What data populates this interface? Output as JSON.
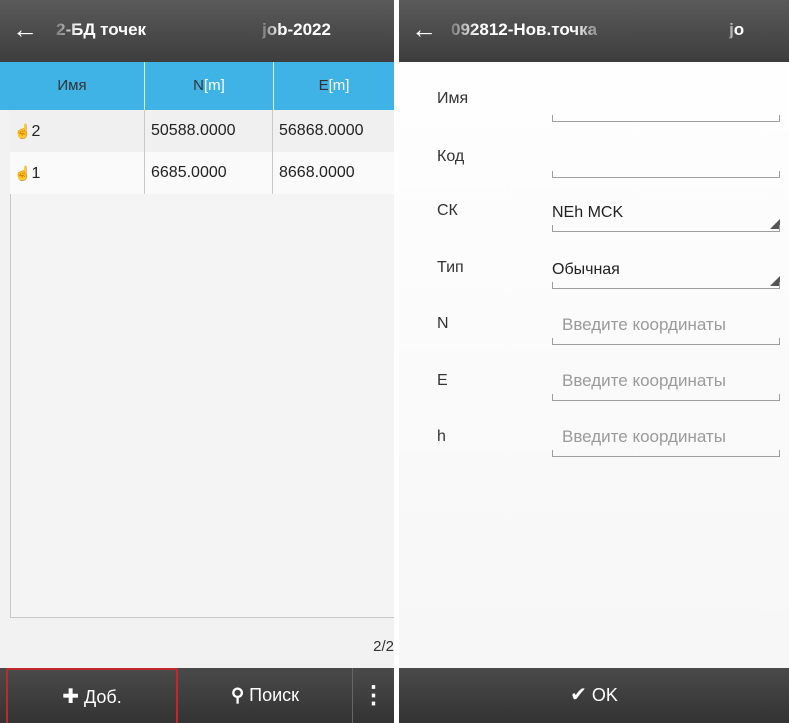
{
  "left": {
    "title_prefix": "2-БД точек",
    "title_job": "job-2022",
    "columns": [
      "Имя",
      "N",
      "E"
    ],
    "unit": "[m]",
    "rows": [
      {
        "name": "2",
        "n": "50588.0000",
        "e": "56868.0000"
      },
      {
        "name": "1",
        "n": "6685.0000",
        "e": "8668.0000"
      }
    ],
    "pager": "2/2",
    "add_label": "Доб.",
    "search_label": "Поиск"
  },
  "right": {
    "title": "092812-Нов.точка",
    "title_job": "jo",
    "fields": [
      {
        "label": "Имя",
        "value": ""
      },
      {
        "label": "Код",
        "value": ""
      },
      {
        "label": "СК",
        "value": "NEh MCK"
      },
      {
        "label": "Тип",
        "value": "Обычная"
      },
      {
        "label": "N",
        "placeholder": "Введите координаты"
      },
      {
        "label": "E",
        "placeholder": "Введите координаты"
      },
      {
        "label": "h",
        "placeholder": "Введите координаты"
      }
    ],
    "ok_label": "OK"
  },
  "colors": {
    "header_bar": "#444444",
    "table_header": "#3fb2e6",
    "bottom_bar": "#3b3b3b",
    "active_border": "#c0282e"
  },
  "icons": [
    "back-arrow-icon",
    "hand-pointer-icon",
    "add-point-icon",
    "search-icon",
    "more-vert-icon",
    "check-icon",
    "dropdown-triangle-icon"
  ]
}
